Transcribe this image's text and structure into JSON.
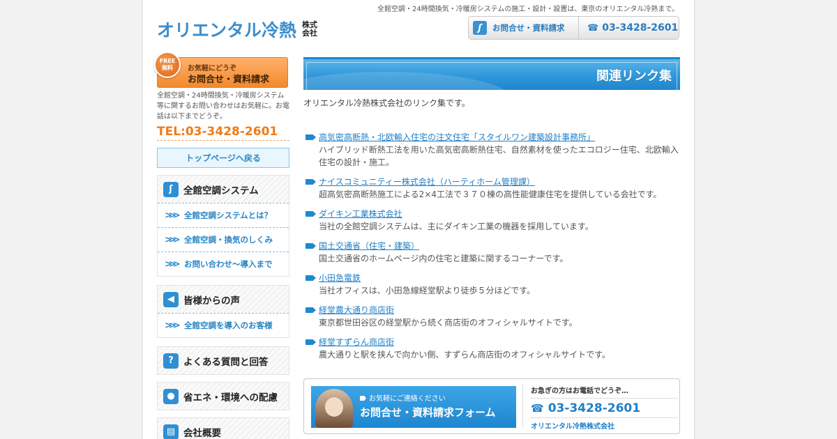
{
  "header": {
    "tagline": "全館空調・24時間換気・冷暖房システムの施工・設計・設置は、東京のオリエンタル冷熱まで。",
    "logo_text": "オリエンタル冷熱",
    "logo_corp": "株式会社",
    "contact_button_label": "お問合せ・資料請求",
    "tel_label": "03-3428-2601"
  },
  "sidebar": {
    "free_badge": "FREE 無料",
    "free_small": "お気軽にどうぞ",
    "free_big": "お問合せ・資料請求",
    "free_desc": "全館空調・24時間換気・冷暖房システム等に関するお問い合わせはお気軽に。お電話は以下までどうぞ。",
    "free_tel": "TEL:03-3428-2601",
    "toppage_label": "トップページへ戻る",
    "groups": [
      {
        "title": "全館空調システム",
        "icon": "logo-s-icon",
        "items": [
          "全館空調システムとは？",
          "全館空調・換気のしくみ",
          "お問い合わせ〜導入まで"
        ]
      },
      {
        "title": "皆様からの声",
        "icon": "speaker-icon",
        "items": [
          "全館空調を導入のお客様"
        ]
      },
      {
        "title": "よくある質問と回答",
        "icon": "question-icon",
        "items": []
      },
      {
        "title": "省エネ・環境への配慮",
        "icon": "drop-icon",
        "items": []
      },
      {
        "title": "会社概要",
        "icon": "building-icon",
        "items": []
      }
    ]
  },
  "main": {
    "page_title": "関連リンク集",
    "intro": "オリエンタル冷熱株式会社のリンク集です。",
    "links": [
      {
        "title": "高気密高断熱・北欧輸入住宅の注文住宅「スタイルワン建築設計事務所」",
        "desc": "ハイブリッド断熱工法を用いた高気密高断熱住宅、自然素材を使ったエコロジー住宅、北欧輸入住宅の設計・施工。"
      },
      {
        "title": "ナイスコミュニティー株式会社（ハーティホーム管理課）",
        "desc": "超高気密高断熱施工による2×4工法で３７０棟の高性能健康住宅を提供している会社です。"
      },
      {
        "title": "ダイキン工業株式会社",
        "desc": "当社の全館空調システムは、主にダイキン工業の機器を採用しています。"
      },
      {
        "title": "国土交通省（住宅・建築）",
        "desc": "国土交通省のホームページ内の住宅と建築に関するコーナーです。"
      },
      {
        "title": "小田急電鉄",
        "desc": "当社オフィスは、小田急線経堂駅より徒歩５分ほどです。"
      },
      {
        "title": "経堂農大通り商店街",
        "desc": "東京都世田谷区の経堂駅から続く商店街のオフィシャルサイトです。"
      },
      {
        "title": "経堂すずらん商店街",
        "desc": "農大通りと駅を挟んで向かい側、すずらん商店街のオフィシャルサイトです。"
      }
    ]
  },
  "contact_box": {
    "small": "お気軽にご連絡ください",
    "big": "お問合せ・資料請求フォーム",
    "note": "お急ぎの方はお電話でどうぞ…",
    "tel": "03-3428-2601",
    "company": "オリエンタル冷熱株式会社"
  },
  "colors": {
    "brand_blue": "#2f8fd3",
    "accent_orange": "#f07a18",
    "link_blue": "#1f7fc7"
  }
}
